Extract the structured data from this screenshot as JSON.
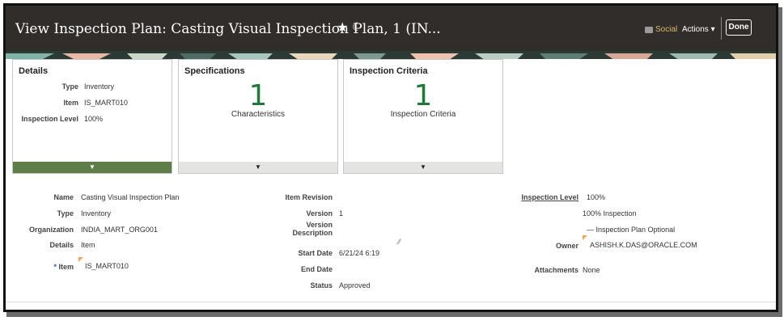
{
  "header": {
    "title": "View Inspection Plan: Casting Visual Inspection Plan, 1 (IN...",
    "social_label": "Social",
    "actions_label": "Actions ▾",
    "done_label": "Done"
  },
  "cards": {
    "details": {
      "title": "Details",
      "rows": [
        {
          "label": "Type",
          "value": "Inventory"
        },
        {
          "label": "Item",
          "value": "IS_MART010"
        },
        {
          "label": "Inspection Level",
          "value": "100%"
        }
      ]
    },
    "specifications": {
      "title": "Specifications",
      "count": "1",
      "subtitle": "Characteristics"
    },
    "criteria": {
      "title": "Inspection Criteria",
      "count": "1",
      "subtitle": "Inspection Criteria"
    }
  },
  "form": {
    "col1": {
      "name_label": "Name",
      "name_value": "Casting Visual Inspection Plan",
      "type_label": "Type",
      "type_value": "Inventory",
      "org_label": "Organization",
      "org_value": "INDIA_MART_ORG001",
      "details_label": "Details",
      "details_value": "Item",
      "item_label": "Item",
      "item_required": "*",
      "item_value": "IS_MART010"
    },
    "col2": {
      "revision_label": "Item Revision",
      "revision_value": "",
      "version_label": "Version",
      "version_value": "1",
      "vdesc_label": "Version Description",
      "vdesc_value": "",
      "start_label": "Start Date",
      "start_value": "6/21/24 6:19",
      "end_label": "End Date",
      "end_value": "",
      "status_label": "Status",
      "status_value": "Approved"
    },
    "col3": {
      "level_label": "Inspection Level",
      "level_value": "100%",
      "level_detail": "100% Inspection",
      "optional_text": "Inspection Plan Optional",
      "owner_label": "Owner",
      "owner_value": "ASHISH.K.DAS@ORACLE.COM",
      "attachments_label": "Attachments",
      "attachments_value": "None"
    }
  }
}
